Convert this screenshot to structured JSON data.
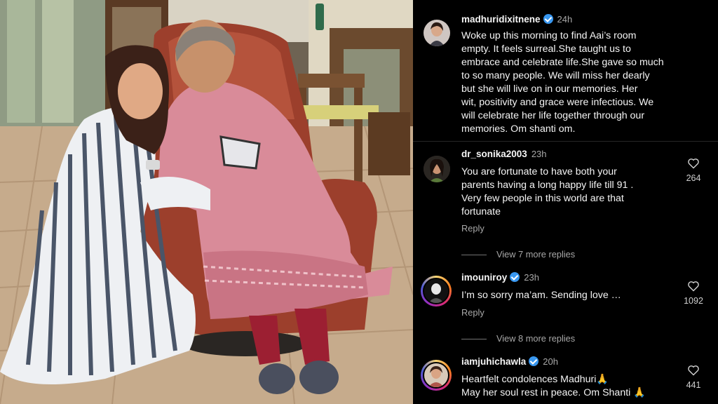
{
  "post": {
    "username": "madhuridixitnene",
    "time": "24h",
    "caption": "Woke up this morning to find Aai’s room\nempty. It feels surreal.She taught us to\nembrace and celebrate life.She gave so much\nto so many people. We will miss her dearly\nbut she will live on in our memories. Her\nwit, positivity and grace were infectious. We\nwill celebrate her life together through our\nmemories. Om shanti om."
  },
  "comments": [
    {
      "username": "dr_sonika2003",
      "time": "23h",
      "verified": false,
      "text": "You are fortunate  to have both your\nparents having a long happy life till 91 .\nVery few people in this world are that\nfortunate",
      "likes": "264",
      "reply_label": "Reply",
      "view_more": "View 7 more replies"
    },
    {
      "username": "imouniroy",
      "time": "23h",
      "verified": true,
      "text": "I’m so sorry ma’am. Sending love …",
      "likes": "1092",
      "reply_label": "Reply",
      "view_more": "View 8 more replies"
    },
    {
      "username": "iamjuhichawla",
      "time": "20h",
      "verified": true,
      "text": "Heartfelt condolences Madhuri🙏\nMay her soul rest in peace. Om Shanti 🙏",
      "likes": "441"
    }
  ],
  "icons": {
    "heart": "heart-outline-icon",
    "verified": "verified-badge-icon"
  },
  "colors": {
    "panel_bg": "#000000",
    "verified_blue": "#3897f0",
    "secondary_text": "#a8a8a8"
  }
}
